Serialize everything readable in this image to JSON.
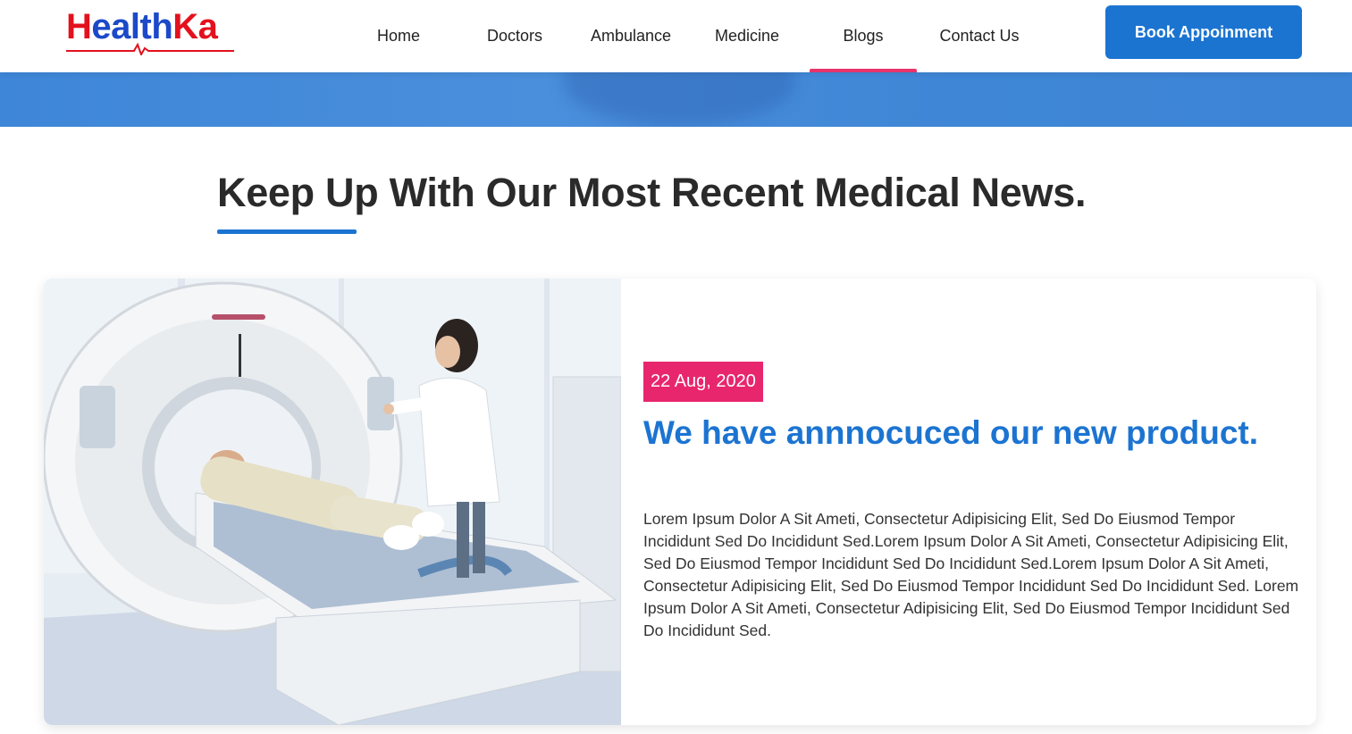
{
  "brand": {
    "logo_first": "H",
    "logo_middle": "ealth",
    "logo_last": "Ka",
    "colors": {
      "red": "#e3111d",
      "blue": "#1b49c9"
    }
  },
  "nav": {
    "items": [
      {
        "label": "Home",
        "active": false
      },
      {
        "label": "Doctors",
        "active": false
      },
      {
        "label": "Ambulance",
        "active": false
      },
      {
        "label": "Medicine",
        "active": false
      },
      {
        "label": "Blogs",
        "active": true
      },
      {
        "label": "Contact Us",
        "active": false
      }
    ],
    "active_color": "#e8336d"
  },
  "header": {
    "book_button": "Book Appoinment",
    "accent": "#1c74d1"
  },
  "section": {
    "title": "Keep Up With Our Most Recent Medical News."
  },
  "post": {
    "image_icon": "ct-scan-photo",
    "date": "22 Aug, 2020",
    "title": "We have annnocuced our new product.",
    "body": "Lorem Ipsum Dolor A Sit Ameti, Consectetur Adipisicing Elit, Sed Do Eiusmod Tempor Incididunt Sed Do Incididunt Sed.Lorem Ipsum Dolor A Sit Ameti, Consectetur Adipisicing Elit, Sed Do Eiusmod Tempor Incididunt Sed Do Incididunt Sed.Lorem Ipsum Dolor A Sit Ameti, Consectetur Adipisicing Elit, Sed Do Eiusmod Tempor Incididunt Sed Do Incididunt Sed. Lorem Ipsum Dolor A Sit Ameti, Consectetur Adipisicing Elit, Sed Do Eiusmod Tempor Incididunt Sed Do Incididunt Sed.",
    "badge_color": "#e8266d"
  }
}
